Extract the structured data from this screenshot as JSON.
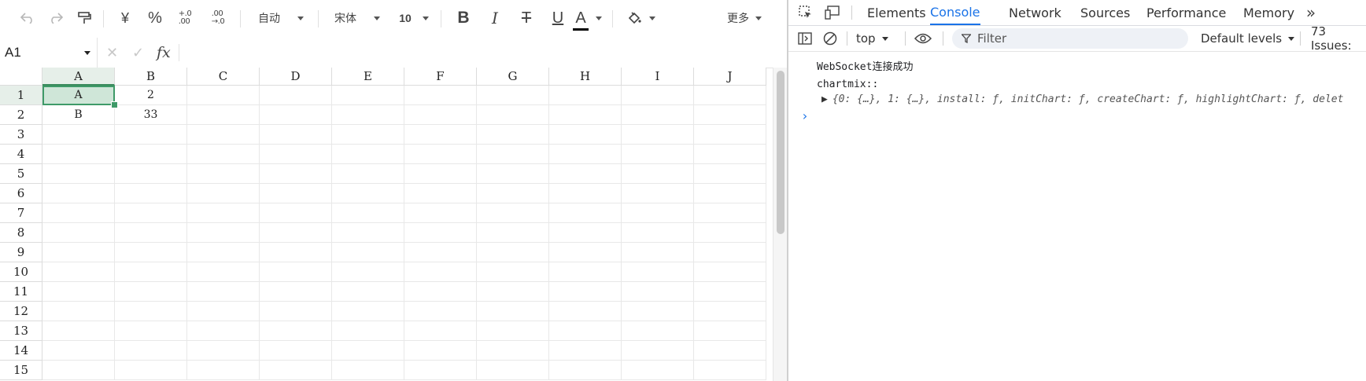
{
  "toolbar": {
    "format_select": "自动",
    "font_select": "宋体",
    "size_select": "10",
    "currency_symbol": "¥",
    "percent_symbol": "%",
    "bold_glyph": "B",
    "italic_glyph": "I",
    "strike_glyph": "T",
    "underline_glyph": "U",
    "font_color_glyph": "A",
    "more_label": "更多",
    "colors": {
      "font_color_bar": "#000000"
    }
  },
  "formula_bar": {
    "name_box": "A1",
    "fx_label": "fx"
  },
  "grid": {
    "columns": [
      "A",
      "B",
      "C",
      "D",
      "E",
      "F",
      "G",
      "H",
      "I",
      "J"
    ],
    "rows": [
      "1",
      "2",
      "3",
      "4",
      "5",
      "6",
      "7",
      "8",
      "9",
      "10",
      "11",
      "12",
      "13",
      "14",
      "15"
    ],
    "cells": {
      "A1": "A",
      "B1": "2",
      "A2": "B",
      "B2": "33"
    },
    "active_cell": "A1"
  },
  "devtools": {
    "tabs": [
      "Elements",
      "Console",
      "Network",
      "Sources",
      "Performance",
      "Memory"
    ],
    "active_tab": "Console",
    "context_select": "top",
    "filter_placeholder": "Filter",
    "levels_select": "Default levels",
    "issues_label": "73 Issues:",
    "accent_color": "#1a73e8"
  },
  "console": {
    "messages": [
      "WebSocket连接成功",
      "chartmix::"
    ],
    "object_preview": "{0: {…}, 1: {…}, install: ƒ, initChart: ƒ, createChart: ƒ, highlightChart: ƒ, delet"
  }
}
